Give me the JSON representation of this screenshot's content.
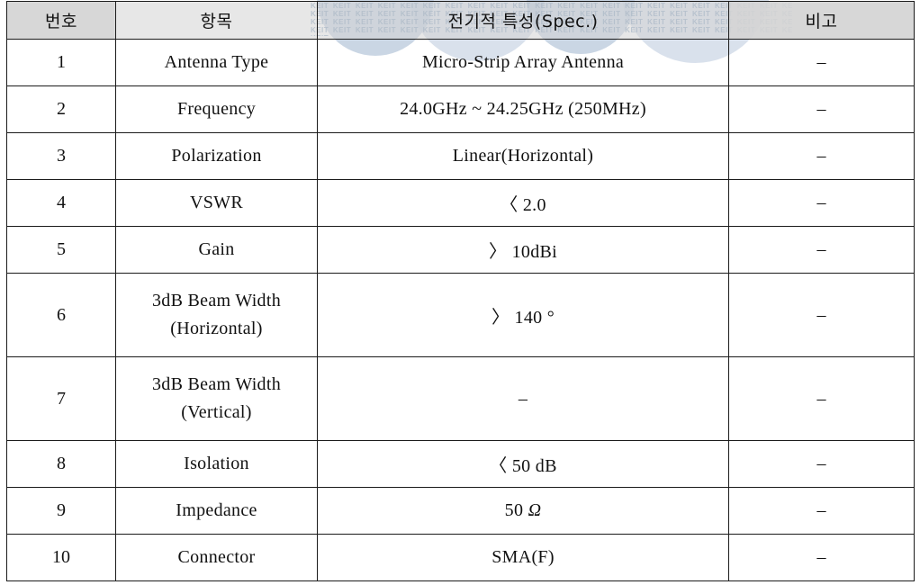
{
  "watermark": {
    "text": "KEIT KEIT KEIT KEIT KEIT KEIT KEIT KEIT KEIT KEIT KEIT KEIT KEIT KEIT KEIT KEIT KEIT KEIT KEIT KEIT KEIT KEIT KEIT KEIT KEIT KEIT KEIT KEIT KEIT KEIT KEIT KEIT KEIT KEIT KEIT KEIT KEIT KEIT KEIT KEIT KEIT KEIT KEIT KEIT KEIT KEIT KEIT KEIT KEIT KEIT KEIT KEIT KEIT KEIT KEIT KEIT KEIT KEIT KEIT KEIT KEIT KEIT KEIT KEIT KEIT KEIT KEIT KEIT KEIT KEIT KEIT KEIT KEIT KEIT KEIT KEIT KEIT KEIT KEIT KEIT KEIT KEIT KEIT KEIT KEIT KEIT KEIT KEIT KEIT KEIT KEIT KEIT KEIT KEIT KEIT KEIT KEIT KEIT KEIT KEIT KEIT KEIT KEIT KEIT KEIT KEIT KEIT KEIT KEIT KEIT KEIT KEIT KEIT KEIT KEIT KEIT KEIT KEIT KEIT KEIT KEIT KEIT KEIT KEIT KEIT KEIT KEIT KEIT KEIT KEIT KEIT KEIT KEIT KEIT KEIT KEIT KEIT KEIT KEIT KEIT KEIT KEIT KEIT KEIT KEIT KEIT KEIT KEIT KEIT KEIT KEIT KEIT",
    "color": "#7e9ab9",
    "logo_color": "#9fb4cd"
  },
  "table": {
    "headers": {
      "no": "번호",
      "item": "항목",
      "spec": "전기적 특성(Spec.)",
      "note": "비고"
    },
    "header_bg": "#d4d4d4",
    "border_color": "#1b1b1b",
    "rows": [
      {
        "no": "1",
        "item": "Antenna Type",
        "item_line2": "",
        "spec": "Micro-Strip Array Antenna",
        "note": "–",
        "tall": false
      },
      {
        "no": "2",
        "item": "Frequency",
        "item_line2": "",
        "spec": "24.0GHz ~ 24.25GHz (250MHz)",
        "note": "–",
        "tall": false
      },
      {
        "no": "3",
        "item": "Polarization",
        "item_line2": "",
        "spec": "Linear(Horizontal)",
        "note": "–",
        "tall": false
      },
      {
        "no": "4",
        "item": "VSWR",
        "item_line2": "",
        "spec": "〈 2.0",
        "note": "–",
        "tall": false
      },
      {
        "no": "5",
        "item": "Gain",
        "item_line2": "",
        "spec": "〉 10dBi",
        "note": "–",
        "tall": false
      },
      {
        "no": "6",
        "item": "3dB Beam Width",
        "item_line2": "(Horizontal)",
        "spec": "〉 140 °",
        "note": "–",
        "tall": true
      },
      {
        "no": "7",
        "item": "3dB Beam Width",
        "item_line2": "(Vertical)",
        "spec": "–",
        "note": "–",
        "tall": true
      },
      {
        "no": "8",
        "item": "Isolation",
        "item_line2": "",
        "spec": "〈 50  dB",
        "note": "–",
        "tall": false
      },
      {
        "no": "9",
        "item": "Impedance",
        "item_line2": "",
        "spec": "50  Ω",
        "note": "–",
        "tall": false
      },
      {
        "no": "10",
        "item": "Connector",
        "item_line2": "",
        "spec": "SMA(F)",
        "note": "–",
        "tall": false
      }
    ]
  }
}
